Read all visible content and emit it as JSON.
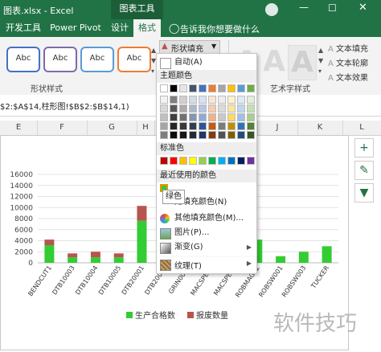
{
  "titlebar": {
    "file": "图表.xlsx - Excel",
    "contextual_tab": "图表工具",
    "account_initial": "",
    "window_controls": [
      "minimize-icon",
      "maximize-icon",
      "close-icon"
    ]
  },
  "tabs": [
    "开发工具",
    "Power Pivot",
    "设计",
    "格式"
  ],
  "tell_me": "告诉我你想要做什么",
  "ribbon": {
    "shape_styles_label": "形状样式",
    "shape_fill_button": "形状填充",
    "art_styles_label": "艺术字样式",
    "text_fill": "文本填充",
    "text_outline": "文本轮廓",
    "text_effects": "文本效果",
    "abc": [
      "Abc",
      "Abc",
      "Abc",
      "Abc"
    ],
    "abc_colors": [
      "#4472c4",
      "#7f6ba8",
      "#5b9bd5",
      "#ed7d31"
    ]
  },
  "formula_bar": {
    "text": "$2:$A$14,柱形图!$B$2:$B$14,1)"
  },
  "columns": [
    "E",
    "F",
    "G",
    "H",
    "I",
    "J",
    "K",
    "L"
  ],
  "dropdown": {
    "auto": "自动(A)",
    "theme_colors_label": "主题颜色",
    "theme_top": [
      "#ffffff",
      "#000000",
      "#e7e6e6",
      "#44546a",
      "#4472c4",
      "#ed7d31",
      "#a5a5a5",
      "#ffc000",
      "#5b9bd5",
      "#70ad47"
    ],
    "theme_shades": [
      [
        "#f2f2f2",
        "#7f7f7f",
        "#d0cece",
        "#d6dce4",
        "#d9e2f3",
        "#fbe5d5",
        "#ededed",
        "#fff2cc",
        "#deebf6",
        "#e2efd9"
      ],
      [
        "#d8d8d8",
        "#595959",
        "#aeabab",
        "#adb9ca",
        "#b4c6e7",
        "#f7cbac",
        "#dbdbdb",
        "#fee599",
        "#bdd7ee",
        "#c5e0b3"
      ],
      [
        "#bfbfbf",
        "#3f3f3f",
        "#757070",
        "#8496b0",
        "#8eaadb",
        "#f4b183",
        "#c9c9c9",
        "#ffd965",
        "#9cc3e5",
        "#a8d08d"
      ],
      [
        "#a5a5a5",
        "#262626",
        "#3a3838",
        "#323f4f",
        "#2f5496",
        "#c55a11",
        "#7b7b7b",
        "#bf8f00",
        "#2e75b5",
        "#538135"
      ],
      [
        "#7f7f7f",
        "#0c0c0c",
        "#171616",
        "#222a35",
        "#1f3864",
        "#833c0b",
        "#525252",
        "#7f6000",
        "#1e4e79",
        "#375623"
      ]
    ],
    "standard_colors_label": "标准色",
    "standard_colors": [
      "#c00000",
      "#ff0000",
      "#ffc000",
      "#ffff00",
      "#92d050",
      "#00b050",
      "#00b0f0",
      "#0070c0",
      "#002060",
      "#7030a0"
    ],
    "recent_colors_label": "最近使用的颜色",
    "recent_colors": [
      "#33cc33"
    ],
    "no_fill": "无填充颜色(N)",
    "more_colors": "其他填充颜色(M)...",
    "picture": "图片(P)...",
    "gradient": "渐变(G)",
    "texture": "纹理(T)",
    "tooltip": "绿色"
  },
  "chart_data": {
    "type": "bar",
    "stacked": true,
    "title": "",
    "categories": [
      "BENDCUT1",
      "DTB10003",
      "DTB10004",
      "DTB10005",
      "DTB20001",
      "DTB20002",
      "GRIN0001",
      "MACSPE02",
      "MACSPE03",
      "ROBMAG02",
      "ROBSW001",
      "ROBSW003",
      "TUCKER"
    ],
    "series": [
      {
        "name": "生产合格数",
        "color": "#33cc33",
        "values": [
          3200,
          1000,
          1000,
          1000,
          7600,
          2500,
          500,
          800,
          1000,
          4200,
          1200,
          2000,
          3000
        ]
      },
      {
        "name": "报废数量",
        "color": "#b85450",
        "values": [
          1000,
          700,
          1000,
          700,
          2700,
          600,
          100,
          100,
          100,
          0,
          0,
          0,
          0
        ]
      }
    ],
    "ylim": [
      0,
      16000
    ],
    "yticks": [
      "0",
      "2000",
      "4000",
      "6000",
      "8000",
      "10000",
      "12000",
      "14000",
      "16000"
    ],
    "grid": true,
    "legend": "bottom"
  },
  "chart_side_buttons": [
    "plus-icon",
    "brush-icon",
    "filter-icon"
  ],
  "watermark": "软件技巧"
}
